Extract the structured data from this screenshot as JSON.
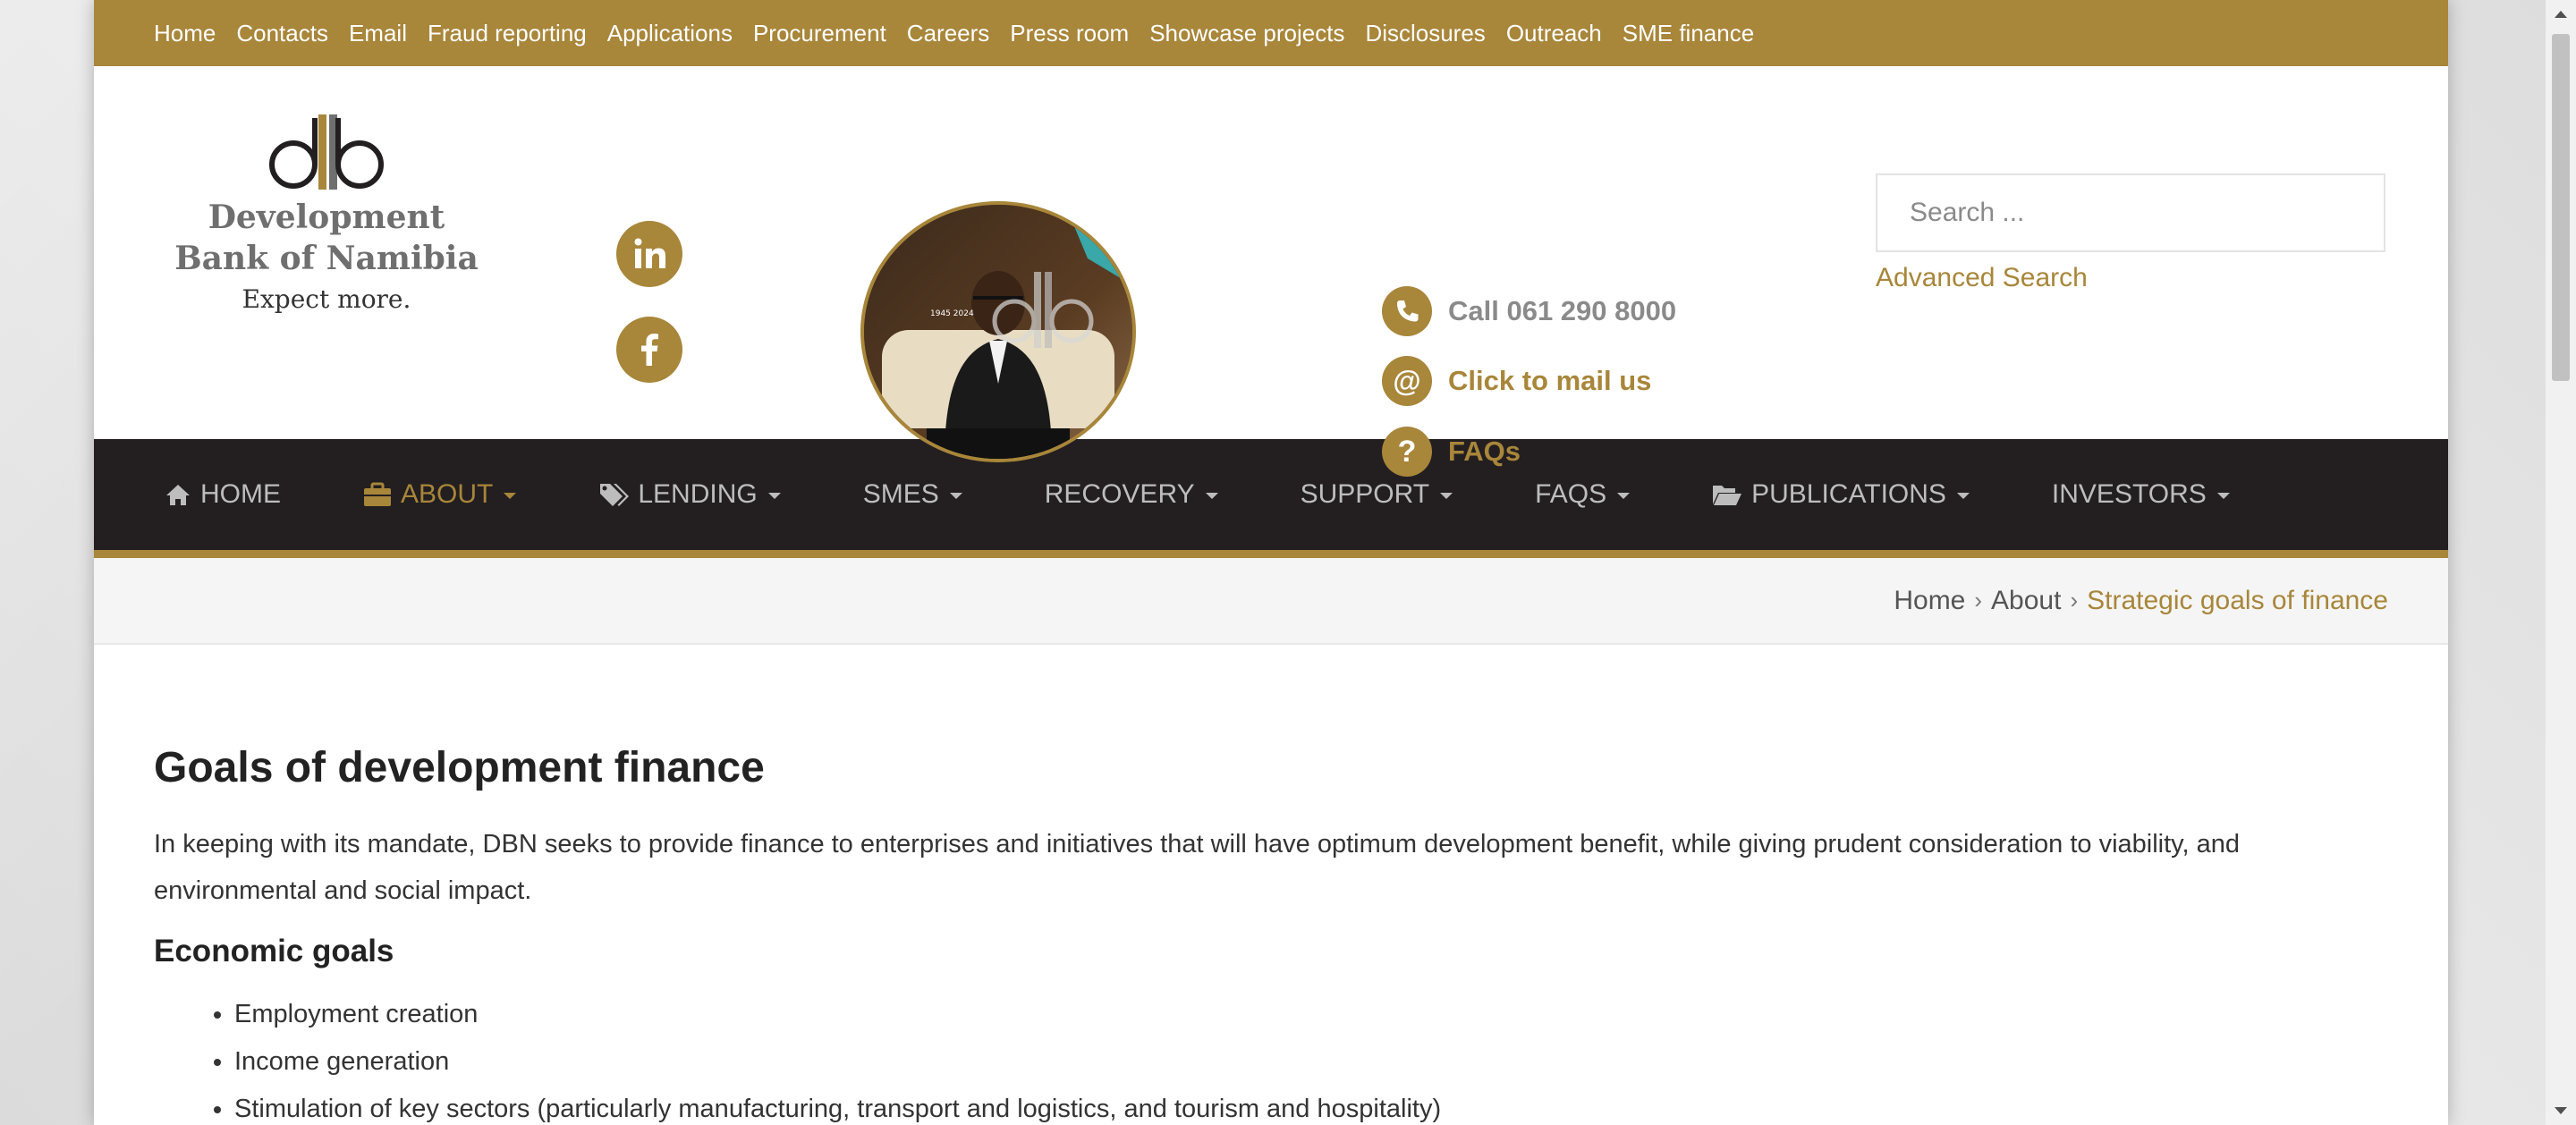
{
  "colors": {
    "brand_gold": "#a8863a",
    "nav_dark": "#231f20",
    "text_dark": "#333333"
  },
  "topbar": {
    "links": [
      "Home",
      "Contacts",
      "Email",
      "Fraud reporting",
      "Applications",
      "Procurement",
      "Careers",
      "Press room",
      "Showcase projects",
      "Disclosures",
      "Outreach",
      "SME finance"
    ]
  },
  "header": {
    "logo_line1": "Development",
    "logo_line2": "Bank of Namibia",
    "logo_tagline": "Expect more.",
    "social": [
      "linkedin-icon",
      "facebook-icon"
    ],
    "portrait_years": "1945 2024",
    "contacts": [
      {
        "icon": "phone-icon",
        "label": "Call 061 290 8000",
        "color": "#8a8a8a"
      },
      {
        "icon": "at-icon",
        "label": "Click to mail us",
        "color": "#a8863a"
      },
      {
        "icon": "question-icon",
        "label": "FAQs",
        "color": "#a8863a"
      }
    ],
    "search_placeholder": "Search ...",
    "advanced_search": "Advanced Search"
  },
  "mainnav": {
    "items": [
      {
        "label": "HOME",
        "icon": "home-icon",
        "caret": false,
        "active": false
      },
      {
        "label": "ABOUT",
        "icon": "briefcase-icon",
        "caret": true,
        "active": true
      },
      {
        "label": "LENDING",
        "icon": "tags-icon",
        "caret": true,
        "active": false
      },
      {
        "label": "SMES",
        "icon": "",
        "caret": true,
        "active": false
      },
      {
        "label": "RECOVERY",
        "icon": "",
        "caret": true,
        "active": false
      },
      {
        "label": "SUPPORT",
        "icon": "",
        "caret": true,
        "active": false
      },
      {
        "label": "FAQS",
        "icon": "",
        "caret": true,
        "active": false
      },
      {
        "label": "PUBLICATIONS",
        "icon": "folder-open-icon",
        "caret": true,
        "active": false
      },
      {
        "label": "INVESTORS",
        "icon": "",
        "caret": true,
        "active": false
      }
    ]
  },
  "breadcrumb": {
    "home": "Home",
    "about": "About",
    "current": "Strategic goals of finance",
    "separator": "›"
  },
  "content": {
    "title": "Goals of development finance",
    "intro": "In keeping with its mandate, DBN seeks to provide finance to enterprises and initiatives that will have optimum development benefit, while giving prudent consideration to viability, and environmental and social impact.",
    "section_heading": "Economic goals",
    "list": [
      "Employment creation",
      "Income generation",
      "Stimulation of key sectors (particularly manufacturing, transport and logistics, and tourism and hospitality)"
    ]
  }
}
